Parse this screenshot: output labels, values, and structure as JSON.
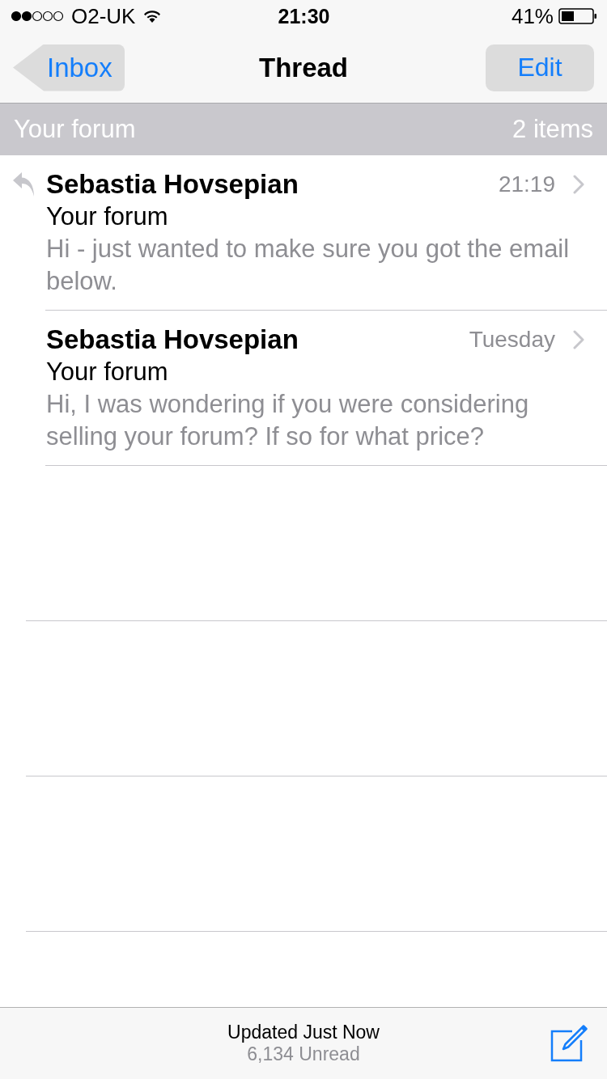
{
  "status_bar": {
    "carrier": "O2-UK",
    "time": "21:30",
    "battery": "41%"
  },
  "nav_bar": {
    "back": "Inbox",
    "title": "Thread",
    "action": "Edit"
  },
  "section": {
    "title": "Your forum",
    "count": "2 items"
  },
  "messages": [
    {
      "sender": "Sebastia Hovsepian",
      "time": "21:19",
      "subject": "Your forum",
      "preview": "Hi - just wanted to make sure you got the email below.",
      "replied": true
    },
    {
      "sender": "Sebastia Hovsepian",
      "time": "Tuesday",
      "subject": "Your forum",
      "preview": "Hi, I was wondering if you were considering selling your forum? If so for what price?",
      "replied": false
    }
  ],
  "toolbar": {
    "status": "Updated Just Now",
    "unread": "6,134 Unread"
  }
}
